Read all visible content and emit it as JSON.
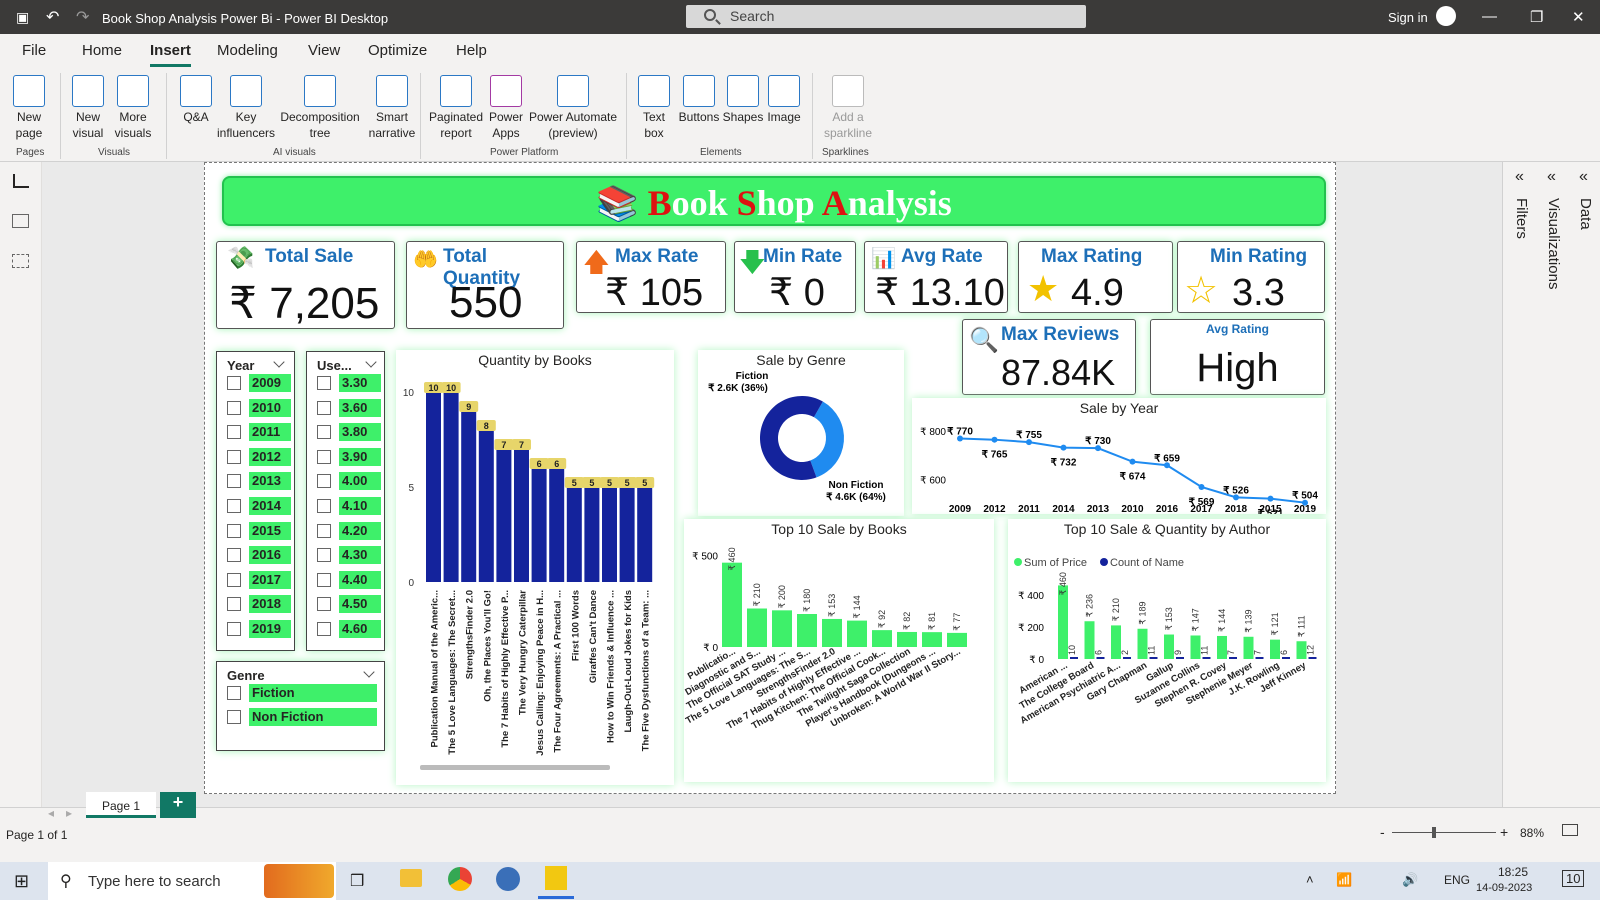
{
  "window": {
    "title": "Book Shop Analysis Power Bi - Power BI Desktop",
    "search_placeholder": "Search",
    "sign_in": "Sign in"
  },
  "menu": [
    "File",
    "Home",
    "Insert",
    "Modeling",
    "View",
    "Optimize",
    "Help"
  ],
  "ribbon": {
    "buttons": [
      {
        "label": "New page",
        "icon": "new-page-icon"
      },
      {
        "label": "New visual",
        "icon": "new-visual-icon"
      },
      {
        "label": "More visuals",
        "icon": "more-visuals-icon"
      },
      {
        "label": "Q&A",
        "icon": "qa-icon"
      },
      {
        "label": "Key influencers",
        "icon": "key-influencers-icon"
      },
      {
        "label": "Decomposition tree",
        "icon": "decomposition-tree-icon"
      },
      {
        "label": "Smart narrative",
        "icon": "smart-narrative-icon"
      },
      {
        "label": "Paginated report",
        "icon": "paginated-report-icon"
      },
      {
        "label": "Power Apps",
        "icon": "power-apps-icon"
      },
      {
        "label": "Power Automate (preview)",
        "icon": "power-automate-icon"
      },
      {
        "label": "Text box",
        "icon": "text-box-icon"
      },
      {
        "label": "Buttons",
        "icon": "buttons-icon"
      },
      {
        "label": "Shapes",
        "icon": "shapes-icon"
      },
      {
        "label": "Image",
        "icon": "image-icon"
      },
      {
        "label": "Add a sparkline",
        "icon": "sparkline-icon"
      }
    ],
    "groups": [
      "Pages",
      "Visuals",
      "AI visuals",
      "Power Platform",
      "Elements",
      "Sparklines"
    ]
  },
  "right_pane": {
    "filters": "Filters",
    "visualizations": "Visualizations",
    "data": "Data"
  },
  "banner": {
    "c1": "B",
    "r1": "ook ",
    "c2": "S",
    "r2": "hop ",
    "c3": "A",
    "r3": "nalysis"
  },
  "kpis": {
    "total_sale": {
      "label": "Total Sale",
      "value": "₹ 7,205"
    },
    "total_quantity": {
      "label": "Total Quantity",
      "value": "550"
    },
    "max_rate": {
      "label": "Max Rate",
      "value": "₹ 105"
    },
    "min_rate": {
      "label": "Min Rate",
      "value": "₹ 0"
    },
    "avg_rate": {
      "label": "Avg Rate",
      "value": "₹ 13.10"
    },
    "max_rating": {
      "label": "Max Rating",
      "value": "4.9"
    },
    "min_rating": {
      "label": "Min Rating",
      "value": "3.3"
    },
    "max_reviews": {
      "label": "Max Reviews",
      "value": "87.84K"
    },
    "avg_rating": {
      "label": "Avg Rating",
      "value": "High"
    }
  },
  "slicers": {
    "year": {
      "header": "Year",
      "items": [
        "2009",
        "2010",
        "2011",
        "2012",
        "2013",
        "2014",
        "2015",
        "2016",
        "2017",
        "2018",
        "2019"
      ]
    },
    "user": {
      "header": "Use...",
      "items": [
        "3.30",
        "3.60",
        "3.80",
        "3.90",
        "4.00",
        "4.10",
        "4.20",
        "4.30",
        "4.40",
        "4.50",
        "4.60"
      ]
    },
    "genre": {
      "header": "Genre",
      "items": [
        "Fiction",
        "Non Fiction"
      ]
    }
  },
  "status": {
    "page_label": "Page 1",
    "page_count": "Page 1 of 1",
    "zoom": "88%",
    "add_page": "+"
  },
  "taskbar": {
    "search_placeholder": "Type here to search",
    "lang": "ENG",
    "time": "18:25",
    "date": "14-09-2023",
    "notif": "10"
  },
  "chart_data": [
    {
      "type": "bar",
      "title": "Quantity by Books",
      "ylim": [
        0,
        10
      ],
      "yticks": [
        "0",
        "5",
        "10"
      ],
      "categories": [
        "Publication Manual of the Americ...",
        "The 5 Love Languages: The Secret...",
        "StrengthsFinder 2.0",
        "Oh, the Places You'll Go!",
        "The 7 Habits of Highly Effective P...",
        "The Very Hungry Caterpillar",
        "Jesus Calling: Enjoying Peace in H...",
        "The Four Agreements: A Practical ...",
        "First 100 Words",
        "Giraffes Can't Dance",
        "How to Win Friends & Influence ...",
        "Laugh-Out-Loud Jokes for Kids",
        "The Five Dysfunctions of a Team: ..."
      ],
      "values": [
        10,
        10,
        9,
        8,
        7,
        7,
        6,
        6,
        5,
        5,
        5,
        5,
        5
      ]
    },
    {
      "type": "pie",
      "title": "Sale by Genre",
      "slices": [
        {
          "name": "Fiction",
          "label": "₹ 2.6K (36%)",
          "value": 2.6,
          "color": "#1f8bf0"
        },
        {
          "name": "Non Fiction",
          "label": "₹ 4.6K (64%)",
          "value": 4.6,
          "color": "#14239c"
        }
      ]
    },
    {
      "type": "line",
      "title": "Sale by Year",
      "ylim": [
        540,
        830
      ],
      "yticks": [
        "₹ 600",
        "₹ 800"
      ],
      "categories": [
        "2009",
        "2012",
        "2011",
        "2014",
        "2013",
        "2010",
        "2016",
        "2017",
        "2018",
        "2015",
        "2019"
      ],
      "values": [
        770,
        765,
        755,
        732,
        730,
        674,
        659,
        569,
        526,
        521,
        504
      ],
      "labels": [
        "₹ 770",
        "₹ 765",
        "₹ 755",
        "₹ 732",
        "₹ 730",
        "₹ 674",
        "₹ 659",
        "₹ 569",
        "₹ 526",
        "₹ 521",
        "₹ 504"
      ]
    },
    {
      "type": "bar",
      "title": "Top 10 Sale by Books",
      "ylim": [
        0,
        600
      ],
      "yticks": [
        "₹ 0",
        "₹ 500"
      ],
      "categories": [
        "Publicatio...",
        "Diagnostic and S...",
        "The Official SAT Study ...",
        "The 5 Love Languages: The S...",
        "StrengthsFinder 2.0",
        "The 7 Habits of Highly Effective ...",
        "Thug Kitchen: The Official Cook...",
        "The Twilight Saga Collection",
        "Player's Handbook (Dungeons ...",
        "Unbroken: A World War II Story..."
      ],
      "values": [
        460,
        210,
        200,
        180,
        153,
        144,
        92,
        82,
        81,
        77
      ],
      "labels": [
        "₹ 460",
        "₹ 210",
        "₹ 200",
        "₹ 180",
        "₹ 153",
        "₹ 144",
        "₹ 92",
        "₹ 82",
        "₹ 81",
        "₹ 77"
      ]
    },
    {
      "type": "bar",
      "title": "Top 10 Sale & Quantity by Author",
      "ylim": [
        0,
        500
      ],
      "yticks": [
        "₹ 0",
        "₹ 200",
        "₹ 400"
      ],
      "categories": [
        "American ...",
        "The College Board",
        "American Psychiatric A...",
        "Gary Chapman",
        "Gallup",
        "Suzanne Collins",
        "Stephen R. Covey",
        "Stephenie Meyer",
        "J.K. Rowling",
        "Jeff Kinney"
      ],
      "series": [
        {
          "name": "Sum of Price",
          "color": "#3ef06a",
          "values": [
            460,
            236,
            210,
            189,
            153,
            147,
            144,
            139,
            121,
            111
          ],
          "labels": [
            "₹ 460",
            "₹ 236",
            "₹ 210",
            "₹ 189",
            "₹ 153",
            "₹ 147",
            "₹ 144",
            "₹ 139",
            "₹ 121",
            "₹ 111"
          ]
        },
        {
          "name": "Count of Name",
          "color": "#14239c",
          "values": [
            10,
            6,
            2,
            11,
            9,
            11,
            7,
            7,
            6,
            12
          ],
          "labels": [
            "10",
            "6",
            "2",
            "11",
            "9",
            "11",
            "7",
            "7",
            "6",
            "12"
          ]
        }
      ]
    }
  ]
}
